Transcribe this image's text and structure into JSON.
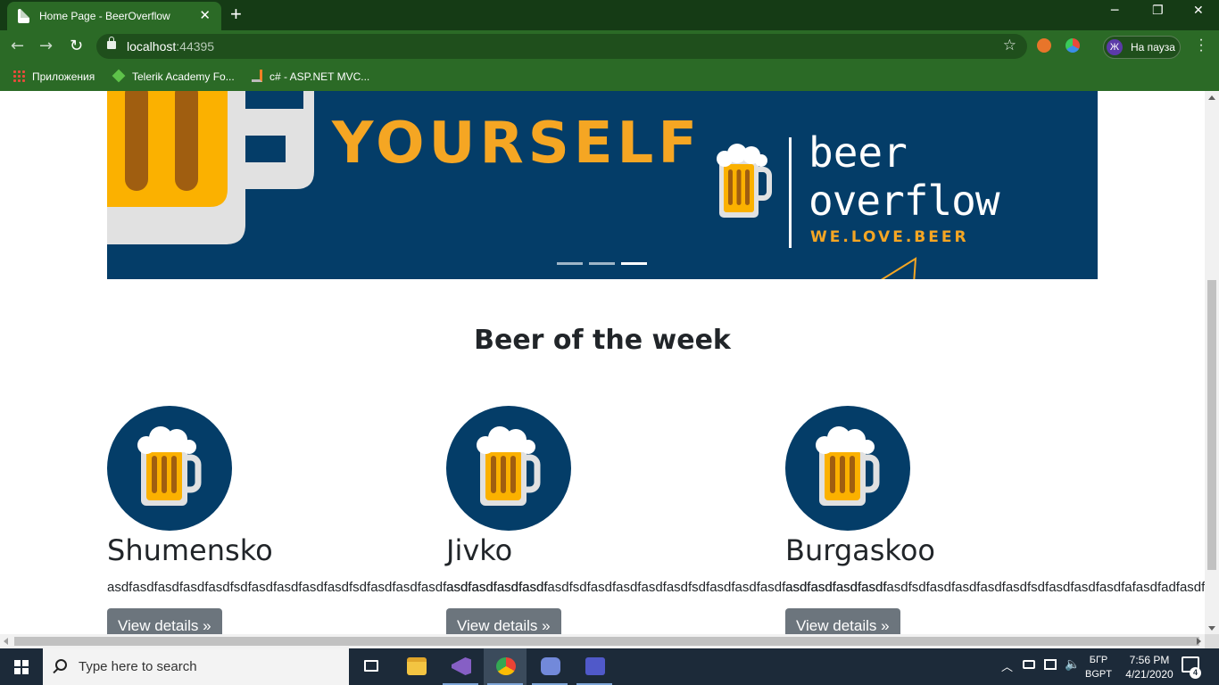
{
  "browser": {
    "tab_title": "Home Page - BeerOverflow",
    "url_host": "localhost",
    "url_port": ":44395",
    "profile_initial": "Ж",
    "profile_label": "На пауза",
    "bookmarks": [
      {
        "label": "Приложения",
        "icon": "apps-grid-icon"
      },
      {
        "label": "Telerik Academy Fo...",
        "icon": "telerik-icon"
      },
      {
        "label": "c# - ASP.NET MVC...",
        "icon": "stackoverflow-icon"
      }
    ]
  },
  "banner": {
    "headline": "YOURSELF",
    "brand_line1": "beer",
    "brand_line2": "overflow",
    "brand_tag": "WE.LOVE.BEER",
    "slides_total": 3,
    "active_slide": 3
  },
  "section": {
    "title": "Beer of the week"
  },
  "beers": [
    {
      "name": "Shumensko",
      "description": "asdfasdfasdfasdfasdfsdfasdfasdfasdfasdfsdfasdfasdfasdfasdfasdfasdfasdf",
      "button": "View details »"
    },
    {
      "name": "Jivko",
      "description": "asdfasdfasdfasdfasdfsdfasdfasdfasdfasdfsdfasdfasdfasdfasdfasdfasdfasdf",
      "button": "View details »"
    },
    {
      "name": "Burgaskoo",
      "description": "asdfasdfasdfasdfasdfsdfasdfasdfasdfasdfsdfasdfasdfasdfafasdfadfasdfasdf",
      "button": "View details »"
    }
  ],
  "taskbar": {
    "search_placeholder": "Type here to search",
    "time": "7:56 PM",
    "date": "4/21/2020",
    "lang_line1": "БГР",
    "lang_line2": "BGPT",
    "notification_count": "4"
  },
  "colors": {
    "chrome_frame": "#153b15",
    "chrome_toolbar": "#2b6a26",
    "banner_bg": "#043d68",
    "accent": "#f5a623",
    "button_bg": "#6c757d"
  }
}
